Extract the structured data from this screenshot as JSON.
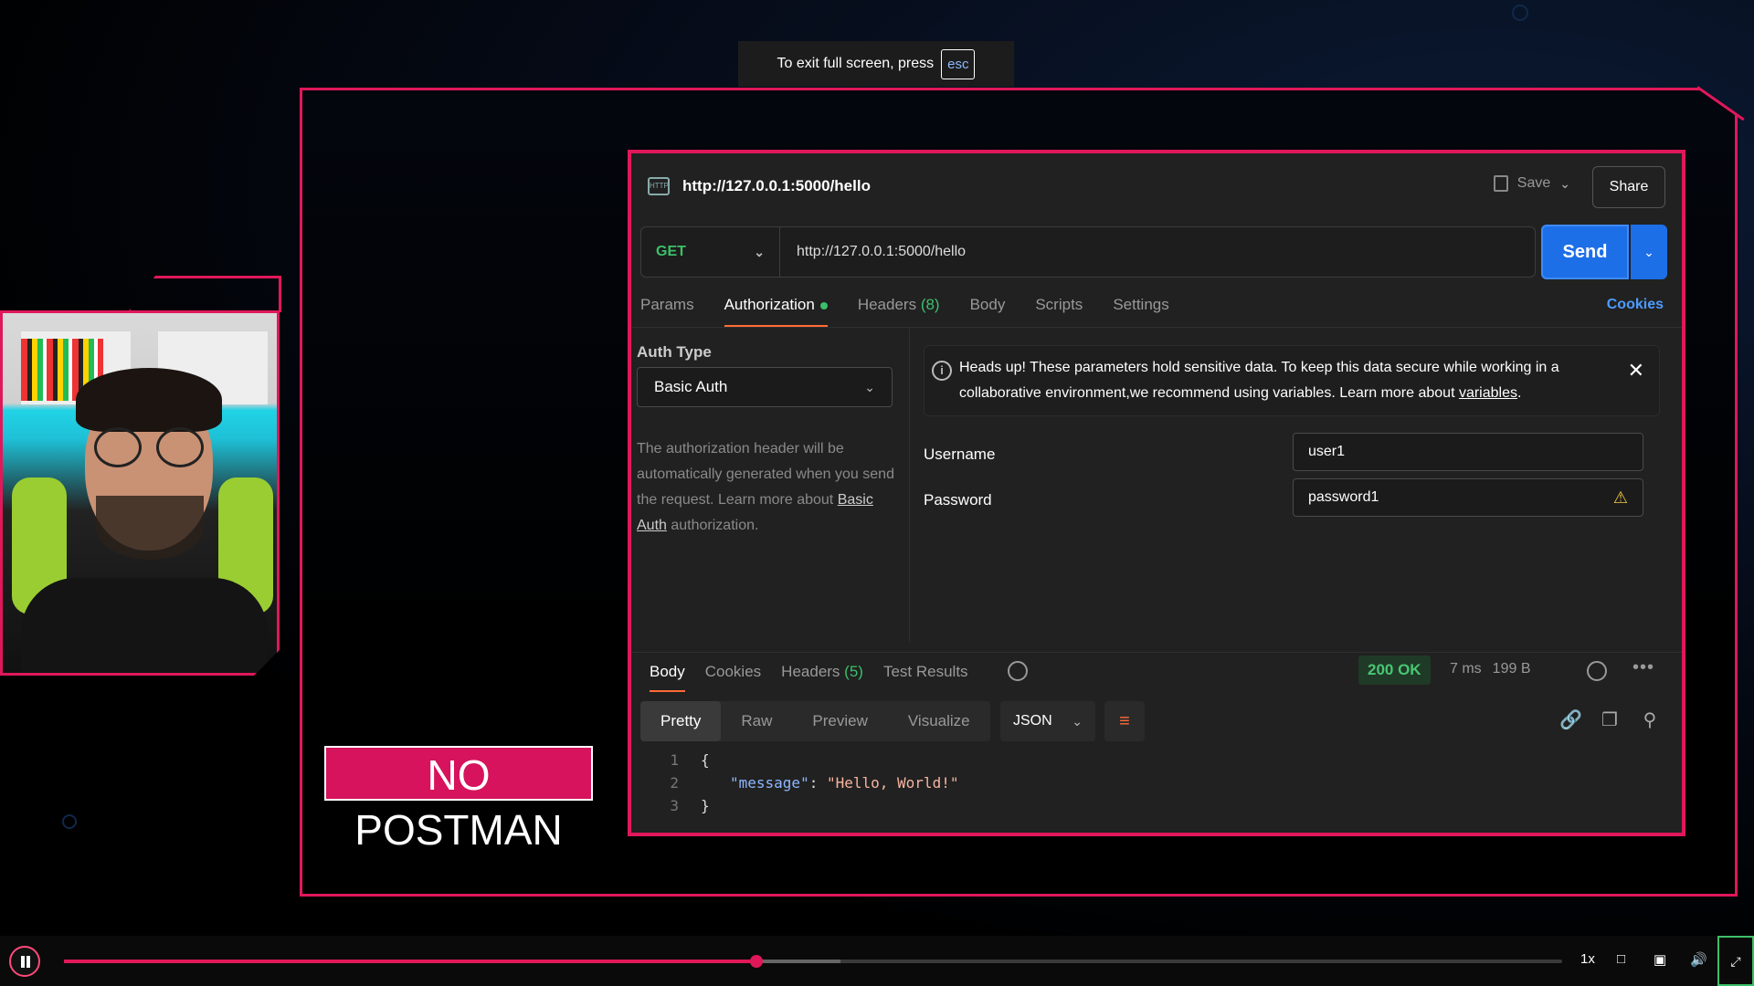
{
  "toast": {
    "text": "To exit full screen, press",
    "key": "esc"
  },
  "badge": {
    "text": "NO POSTMAN"
  },
  "postman": {
    "title": "http://127.0.0.1:5000/hello",
    "save_label": "Save",
    "share_label": "Share",
    "method": "GET",
    "url": "http://127.0.0.1:5000/hello",
    "send_label": "Send",
    "tabs": [
      {
        "label": "Params"
      },
      {
        "label": "Authorization"
      },
      {
        "label": "Headers",
        "count": "(8)"
      },
      {
        "label": "Body"
      },
      {
        "label": "Scripts"
      },
      {
        "label": "Settings"
      }
    ],
    "cookies_label": "Cookies",
    "auth_type_label": "Auth Type",
    "auth_type_value": "Basic Auth",
    "auth_desc_pre": "The authorization header will be automatically generated when you send the request. Learn more about ",
    "auth_desc_link": "Basic Auth",
    "auth_desc_post": " authorization.",
    "banner_text": "Heads up! These parameters hold sensitive data. To keep this data secure while working in a collaborative environment,we recommend using variables. Learn more about ",
    "banner_link": "variables",
    "banner_end": ".",
    "username_label": "Username",
    "username_value": "user1",
    "password_label": "Password",
    "password_value": "password1",
    "response": {
      "tabs": [
        {
          "label": "Body"
        },
        {
          "label": "Cookies"
        },
        {
          "label": "Headers",
          "count": "(5)"
        },
        {
          "label": "Test Results"
        }
      ],
      "status": "200 OK",
      "time": "7 ms",
      "size": "199 B",
      "views": [
        "Pretty",
        "Raw",
        "Preview",
        "Visualize"
      ],
      "format": "JSON",
      "code_lines": [
        {
          "n": "1",
          "text": "{"
        },
        {
          "n": "2",
          "key": "\"message\"",
          "sep": ": ",
          "value": "\"Hello, World!\""
        },
        {
          "n": "3",
          "text": "}"
        }
      ]
    }
  },
  "player": {
    "progress": 0.462,
    "buffered": 0.518,
    "speed": "1x"
  },
  "colors": {
    "accent": "#e0185a",
    "send": "#1d6fe8",
    "ok": "#48c774"
  }
}
